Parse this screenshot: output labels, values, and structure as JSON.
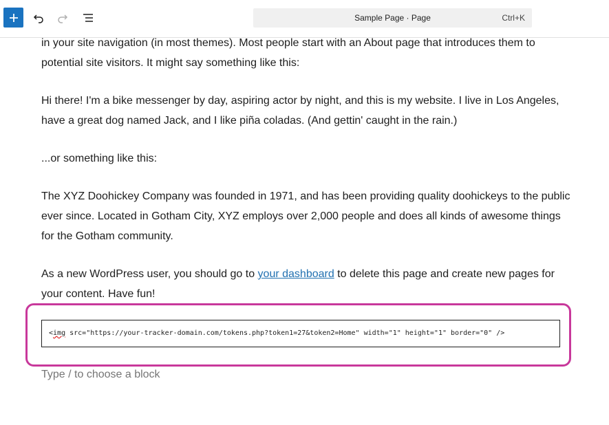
{
  "toolbar": {
    "add_icon": "plus-icon",
    "undo_icon": "undo-icon",
    "redo_icon": "redo-icon",
    "outline_icon": "list-view-icon",
    "command_title": "Sample Page · Page",
    "command_shortcut": "Ctrl+K"
  },
  "content": {
    "para1_line": "in your site navigation (in most themes). Most people start with an About page that introduces them to potential site visitors. It might say something like this:",
    "para2": "Hi there! I'm a bike messenger by day, aspiring actor by night, and this is my website. I live in Los Angeles, have a great dog named Jack, and I like piña coladas. (And gettin' caught in the rain.)",
    "para3": "...or something like this:",
    "para4": "The XYZ Doohickey Company was founded in 1971, and has been providing quality doohickeys to the public ever since. Located in Gotham City, XYZ employs over 2,000 people and does all kinds of awesome things for the Gotham community.",
    "para5_before": "As a new WordPress user, you should go to ",
    "para5_link": "your dashboard",
    "para5_after": " to delete this page and create new pages for your content. Have fun!"
  },
  "html_block": {
    "code_open": "<",
    "code_tag": "img",
    "code_rest": " src=\"https://your-tracker-domain.com/tokens.php?token1=27&token2=Home\" width=\"1\" height=\"1\" border=\"0\" />"
  },
  "placeholder": "Type / to choose a block",
  "colors": {
    "accent": "#1a73c0",
    "highlight": "#c8389b",
    "link": "#2271b1"
  }
}
